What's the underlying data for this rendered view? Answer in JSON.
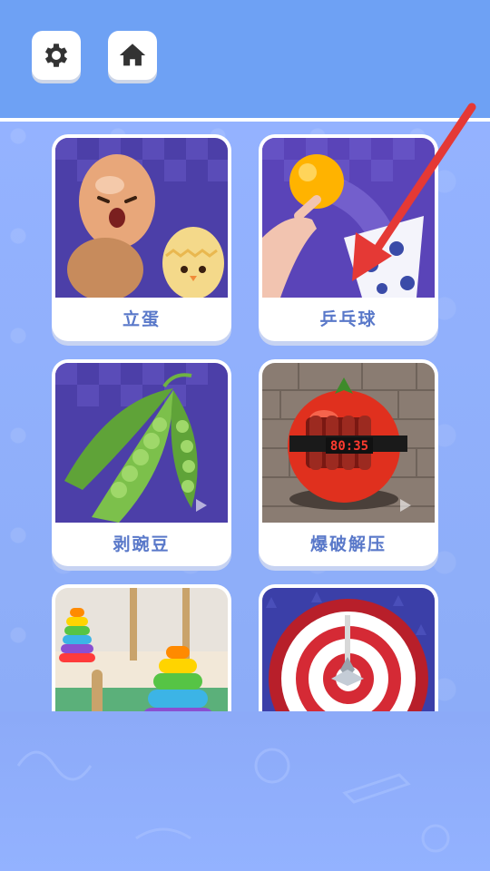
{
  "header": {
    "settings_icon": "gear-icon",
    "home_icon": "home-icon",
    "colors": {
      "header_bg": "#6ea1f4",
      "body_bg": "#8fb0ff",
      "label_color": "#5978c9"
    }
  },
  "games": [
    {
      "label": "立蛋",
      "icon": "egg-icon"
    },
    {
      "label": "乒乓球",
      "icon": "ping-pong-icon"
    },
    {
      "label": "剥豌豆",
      "icon": "pea-pod-icon"
    },
    {
      "label": "爆破解压",
      "icon": "tomato-bomb-icon"
    },
    {
      "label": "",
      "icon": "stacking-rings-icon"
    },
    {
      "label": "",
      "icon": "dartboard-icon"
    }
  ],
  "bomb_timer": "80:35",
  "pointer": {
    "icon": "red-arrow-icon",
    "color": "#e53935"
  }
}
